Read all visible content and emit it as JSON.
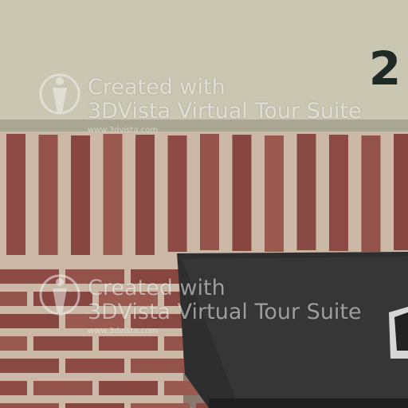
{
  "scene": {
    "house_number": "2"
  },
  "watermarks": [
    {
      "line1": "Created with",
      "line2": "3DVista Virtual Tour Suite",
      "url": "www.3dvista.com"
    },
    {
      "line1": "Created with",
      "line2": "3DVista Virtual Tour Suite",
      "url": "www.3dvista.com"
    }
  ],
  "colors": {
    "stucco": "#c9c6b2",
    "brick": "#8e4a45",
    "mortar": "#cbb8a6",
    "shadow_overhang": "#2b2b2b"
  }
}
